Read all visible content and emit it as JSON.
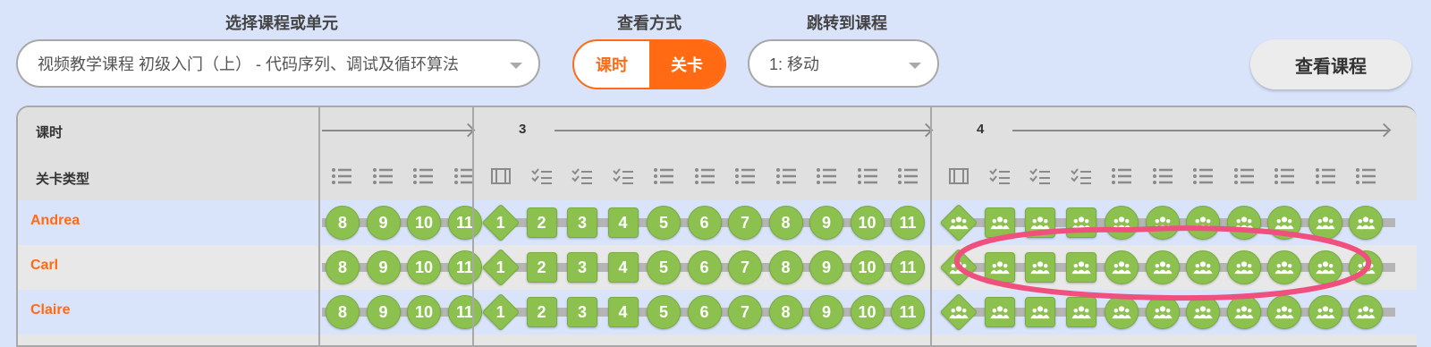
{
  "controls": {
    "course_label": "选择课程或单元",
    "course_value": "视频教学课程 初级入门（上） - 代码序列、调试及循环算法",
    "view_label": "查看方式",
    "view_option_lesson": "课时",
    "view_option_level": "关卡",
    "view_selected": "关卡",
    "jump_label": "跳转到课程",
    "jump_value": "1: 移动",
    "view_course_button": "查看课程"
  },
  "table": {
    "lesson_header": "课时",
    "type_header": "关卡类型",
    "lessons": [
      "3",
      "4"
    ],
    "group0_numbers": [
      "8",
      "9",
      "10",
      "11"
    ],
    "group1_numbers": [
      "1",
      "2",
      "3",
      "4",
      "5",
      "6",
      "7",
      "8",
      "9",
      "10",
      "11"
    ],
    "students": [
      {
        "name": "Andrea"
      },
      {
        "name": "Carl"
      },
      {
        "name": "Claire"
      }
    ],
    "colors": {
      "accent": "#ff6a13",
      "bubble": "#8cc150",
      "annotation": "#f0507e"
    }
  }
}
